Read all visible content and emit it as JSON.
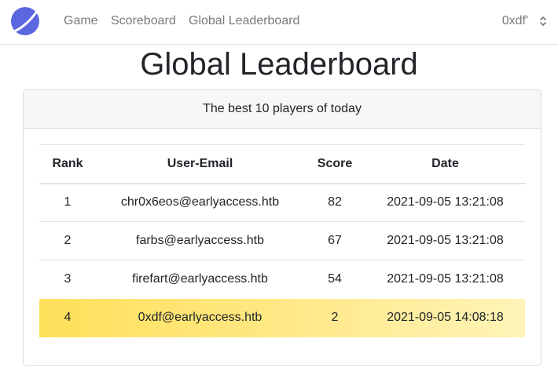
{
  "navbar": {
    "logo_icon": "planet-logo-icon",
    "links": [
      {
        "label": "Game"
      },
      {
        "label": "Scoreboard"
      },
      {
        "label": "Global Leaderboard"
      }
    ],
    "user": "0xdf'",
    "user_menu_icon": "chevron-up-down-icon"
  },
  "page": {
    "title": "Global Leaderboard"
  },
  "card": {
    "header": "The best 10 players of today"
  },
  "table": {
    "columns": [
      "Rank",
      "User-Email",
      "Score",
      "Date"
    ],
    "rows": [
      {
        "rank": "1",
        "email": "chr0x6eos@earlyaccess.htb",
        "score": "82",
        "date": "2021-09-05 13:21:08",
        "highlighted": false
      },
      {
        "rank": "2",
        "email": "farbs@earlyaccess.htb",
        "score": "67",
        "date": "2021-09-05 13:21:08",
        "highlighted": false
      },
      {
        "rank": "3",
        "email": "firefart@earlyaccess.htb",
        "score": "54",
        "date": "2021-09-05 13:21:08",
        "highlighted": false
      },
      {
        "rank": "4",
        "email": "0xdf@earlyaccess.htb",
        "score": "2",
        "date": "2021-09-05 14:08:18",
        "highlighted": true
      }
    ]
  },
  "colors": {
    "highlight_start": "#ffe05a",
    "highlight_end": "#fff4b8",
    "logo": "#5a67e0"
  }
}
